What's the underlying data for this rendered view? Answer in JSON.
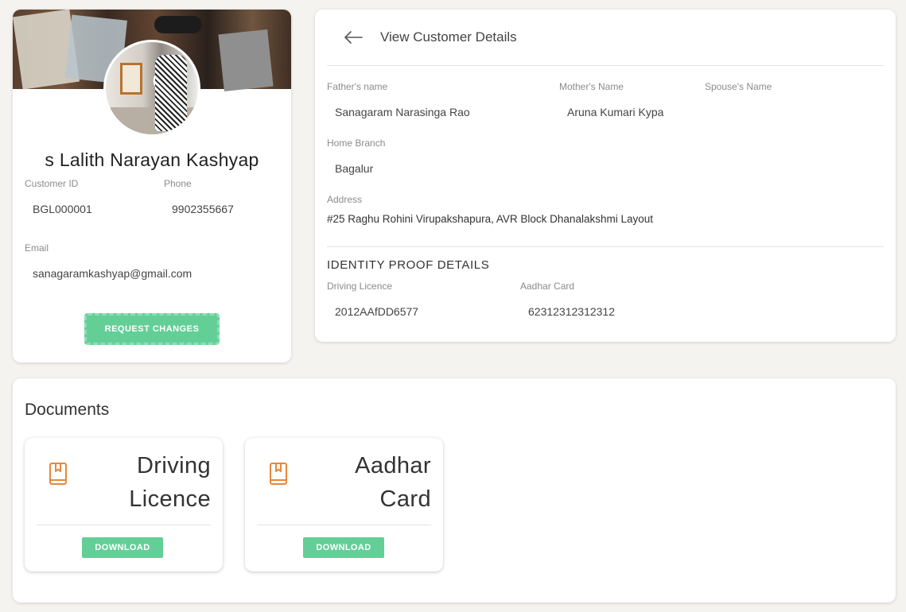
{
  "profile": {
    "name": "s Lalith Narayan Kashyap",
    "customer_id_label": "Customer ID",
    "customer_id": "BGL000001",
    "phone_label": "Phone",
    "phone": "9902355667",
    "email_label": "Email",
    "email": "sanagaramkashyap@gmail.com",
    "request_changes_label": "REQUEST CHANGES"
  },
  "details": {
    "title": "View Customer Details",
    "back_icon": "arrow-left-icon",
    "fathers_name_label": "Father's name",
    "fathers_name": "Sanagaram Narasinga Rao",
    "mothers_name_label": "Mother's Name",
    "mothers_name": "Aruna Kumari Kypa",
    "spouses_name_label": "Spouse's Name",
    "spouses_name": "",
    "home_branch_label": "Home Branch",
    "home_branch": "Bagalur",
    "address_label": "Address",
    "address": "#25 Raghu Rohini Virupakshapura, AVR Block Dhanalakshmi Layout",
    "identity_title": "IDENTITY PROOF DETAILS",
    "driving_licence_label": "Driving Licence",
    "driving_licence": "2012AAfDD6577",
    "aadhar_label": "Aadhar Card",
    "aadhar": "62312312312312"
  },
  "documents": {
    "title": "Documents",
    "items": [
      {
        "name": "Driving Licence",
        "icon": "book-bookmark-icon",
        "download_label": "DOWNLOAD"
      },
      {
        "name": "Aadhar Card",
        "icon": "book-bookmark-icon",
        "download_label": "DOWNLOAD"
      }
    ]
  },
  "colors": {
    "background": "#f4f3ef",
    "accent_green": "#63cf97",
    "icon_orange": "#e8873a"
  }
}
